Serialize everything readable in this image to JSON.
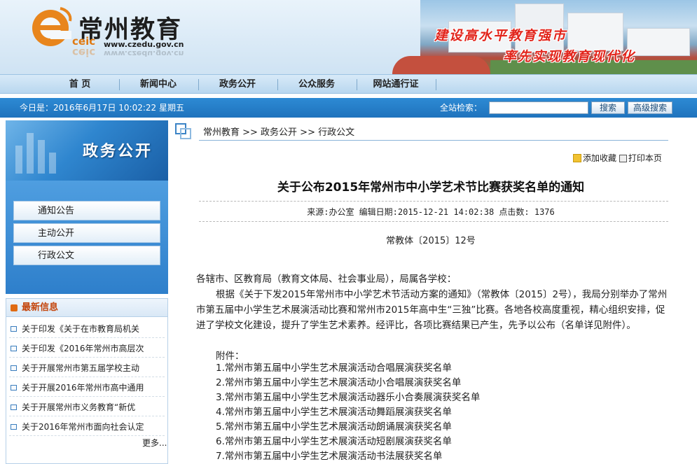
{
  "header": {
    "site_title": "常州教育",
    "site_url": "www.czedu.gov.cn",
    "logo_text": "ceic",
    "slogan_line1": "建设高水平教育强市",
    "slogan_line2": "率先实现教育现代化"
  },
  "nav": {
    "items": [
      "首 页",
      "新闻中心",
      "政务公开",
      "公众服务",
      "网站通行证"
    ]
  },
  "infobar": {
    "date": "今日是：2016年6月17日 10:02:22 星期五",
    "search_label": "全站检索：",
    "search_value": "",
    "search_button": "搜索",
    "advanced_button": "高级搜索"
  },
  "sidebar": {
    "section_title": "政务公开",
    "links": [
      "通知公告",
      "主动公开",
      "行政公文"
    ],
    "news_title": "最新信息",
    "news_items": [
      "关于印发《关于在市教育局机关",
      "关于印发《2016年常州市高层次",
      "关于开展常州市第五届学校主动",
      "关于开展2016年常州市高中通用",
      "关于开展常州市义务教育“新优",
      "关于2016年常州市面向社会认定"
    ],
    "more": "更多..."
  },
  "breadcrumb": "常州教育 >> 政务公开 >> 行政公文",
  "tools": {
    "favorite": "添加收藏",
    "print": "打印本页"
  },
  "article": {
    "title": "关于公布2015年常州市中小学艺术节比赛获奖名单的通知",
    "meta": "来源:办公室   编辑日期:2015-12-21 14:02:38   点击数: 1376",
    "doc_number": "常教体〔2015〕12号",
    "salutation": "各辖市、区教育局（教育文体局、社会事业局），局属各学校：",
    "body": "根据《关于下发2015年常州市中小学艺术节活动方案的通知》（常教体〔2015〕2号），我局分别举办了常州市第五届中小学生艺术展演活动比赛和常州市2015年高中生“三独”比赛。各地各校高度重视，精心组织安排，促进了学校文化建设，提升了学生艺术素养。经评比，各项比赛结果已产生，先予以公布（名单详见附件）。",
    "attachments_label": "附件：",
    "attachments": [
      "1.常州市第五届中小学生艺术展演活动合唱展演获奖名单",
      "2.常州市第五届中小学生艺术展演活动小合唱展演获奖名单",
      "3.常州市第五届中小学生艺术展演活动器乐小合奏展演获奖名单",
      "4.常州市第五届中小学生艺术展演活动舞蹈展演获奖名单",
      "5.常州市第五届中小学生艺术展演活动朗诵展演获奖名单",
      "6.常州市第五届中小学生艺术展演活动短剧展演获奖名单",
      "7.常州市第五届中小学生艺术展演活动书法展获奖名单"
    ]
  },
  "colors": {
    "nav_bg": "#c6def2",
    "infobar_bg": "#2580c9",
    "slogan": "#e2251c",
    "news_title": "#c4450b"
  }
}
